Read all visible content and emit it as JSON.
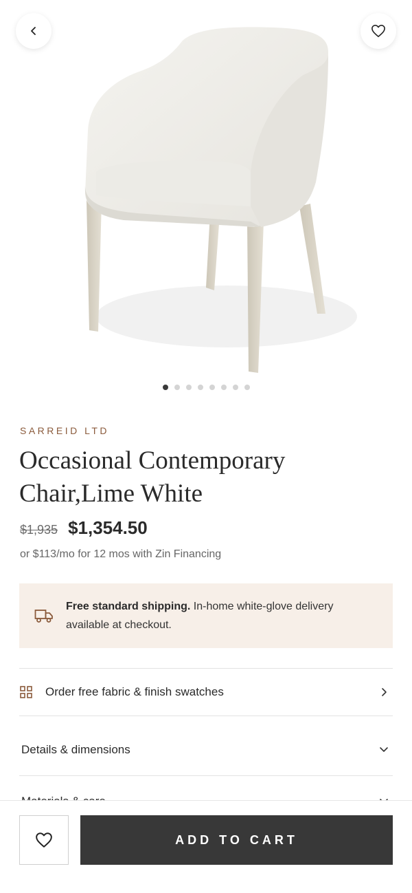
{
  "navigation": {
    "back_icon": "chevron-left-icon",
    "favorite_icon": "heart-outline-icon"
  },
  "gallery": {
    "image_count": 8,
    "active_index": 0
  },
  "product": {
    "brand": "SARREID LTD",
    "title": "Occasional Contemporary Chair,Lime White",
    "original_price": "$1,935",
    "sale_price": "$1,354.50",
    "financing": "or $113/mo for 12 mos with Zin Financing"
  },
  "shipping": {
    "icon": "truck-icon",
    "headline": "Free standard shipping.",
    "detail": " In-home white-glove delivery available at checkout."
  },
  "rows": {
    "swatches_label": "Order free fabric & finish swatches",
    "details_label": "Details & dimensions",
    "materials_label": "Materials & care"
  },
  "cart_bar": {
    "wishlist_icon": "heart-outline-icon",
    "add_to_cart_label": "ADD TO CART"
  },
  "colors": {
    "brand_accent": "#8a5a3b",
    "shipping_bg": "#f7efe8",
    "cart_button_bg": "#383838",
    "dot_active": "#3a3a3a",
    "dot_inactive": "#d4d4d4"
  }
}
